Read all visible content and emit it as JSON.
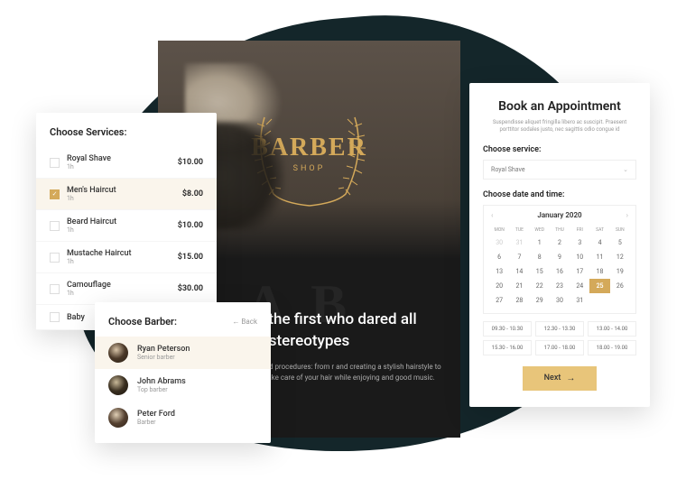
{
  "hero": {
    "logo_main": "BARBER",
    "logo_sub": "SHOP",
    "watermark": "AB",
    "title": "ershop is the first who dared all stereotypes",
    "desc": "s includes many methods and procedures: from r and creating a stylish hairstyle to correcting a g eyebrows. Take care of your hair while enjoying and good music."
  },
  "services": {
    "title": "Choose Services:",
    "items": [
      {
        "name": "Royal Shave",
        "dur": "1h",
        "price": "$10.00",
        "selected": false
      },
      {
        "name": "Men's Haircut",
        "dur": "1h",
        "price": "$8.00",
        "selected": true
      },
      {
        "name": "Beard Haircut",
        "dur": "1h",
        "price": "$10.00",
        "selected": false
      },
      {
        "name": "Mustache Haircut",
        "dur": "1h",
        "price": "$15.00",
        "selected": false
      },
      {
        "name": "Camouflage",
        "dur": "1h",
        "price": "$30.00",
        "selected": false
      },
      {
        "name": "Baby",
        "dur": "",
        "price": "",
        "selected": false
      }
    ]
  },
  "barbers": {
    "title": "Choose Barber:",
    "back": "←   Back",
    "items": [
      {
        "name": "Ryan Peterson",
        "role": "Senior barber",
        "selected": true
      },
      {
        "name": "John Abrams",
        "role": "Top barber",
        "selected": false
      },
      {
        "name": "Peter Ford",
        "role": "Barber",
        "selected": false
      }
    ]
  },
  "booking": {
    "title": "Book an Appointment",
    "sub": "Suspendisse aliquet fringilla libero ac suscipit. Praesent porttitor sodales justo, nec sagittis odio congue id",
    "service_label": "Choose service:",
    "service_value": "Royal Shave",
    "datetime_label": "Choose date and time:",
    "month": "January",
    "year": "2020",
    "dow": [
      "MON",
      "TUE",
      "WED",
      "THU",
      "FRI",
      "SAT",
      "SUN"
    ],
    "days": [
      {
        "n": "30",
        "out": true
      },
      {
        "n": "31",
        "out": true
      },
      {
        "n": "1"
      },
      {
        "n": "2"
      },
      {
        "n": "3"
      },
      {
        "n": "4"
      },
      {
        "n": "5"
      },
      {
        "n": "6"
      },
      {
        "n": "7"
      },
      {
        "n": "8"
      },
      {
        "n": "9"
      },
      {
        "n": "10"
      },
      {
        "n": "11"
      },
      {
        "n": "12"
      },
      {
        "n": "13"
      },
      {
        "n": "14"
      },
      {
        "n": "15"
      },
      {
        "n": "16"
      },
      {
        "n": "17"
      },
      {
        "n": "18"
      },
      {
        "n": "19"
      },
      {
        "n": "20"
      },
      {
        "n": "21"
      },
      {
        "n": "22"
      },
      {
        "n": "23"
      },
      {
        "n": "24"
      },
      {
        "n": "25",
        "sel": true
      },
      {
        "n": "26"
      },
      {
        "n": "27"
      },
      {
        "n": "28"
      },
      {
        "n": "29"
      },
      {
        "n": "30"
      },
      {
        "n": "31"
      }
    ],
    "slots": [
      "09.30 - 10.30",
      "12.30 - 13.30",
      "13.00 - 14.00",
      "15.30 - 16.00",
      "17.00 - 18.00",
      "18.00 - 19.00"
    ],
    "next": "Next"
  }
}
